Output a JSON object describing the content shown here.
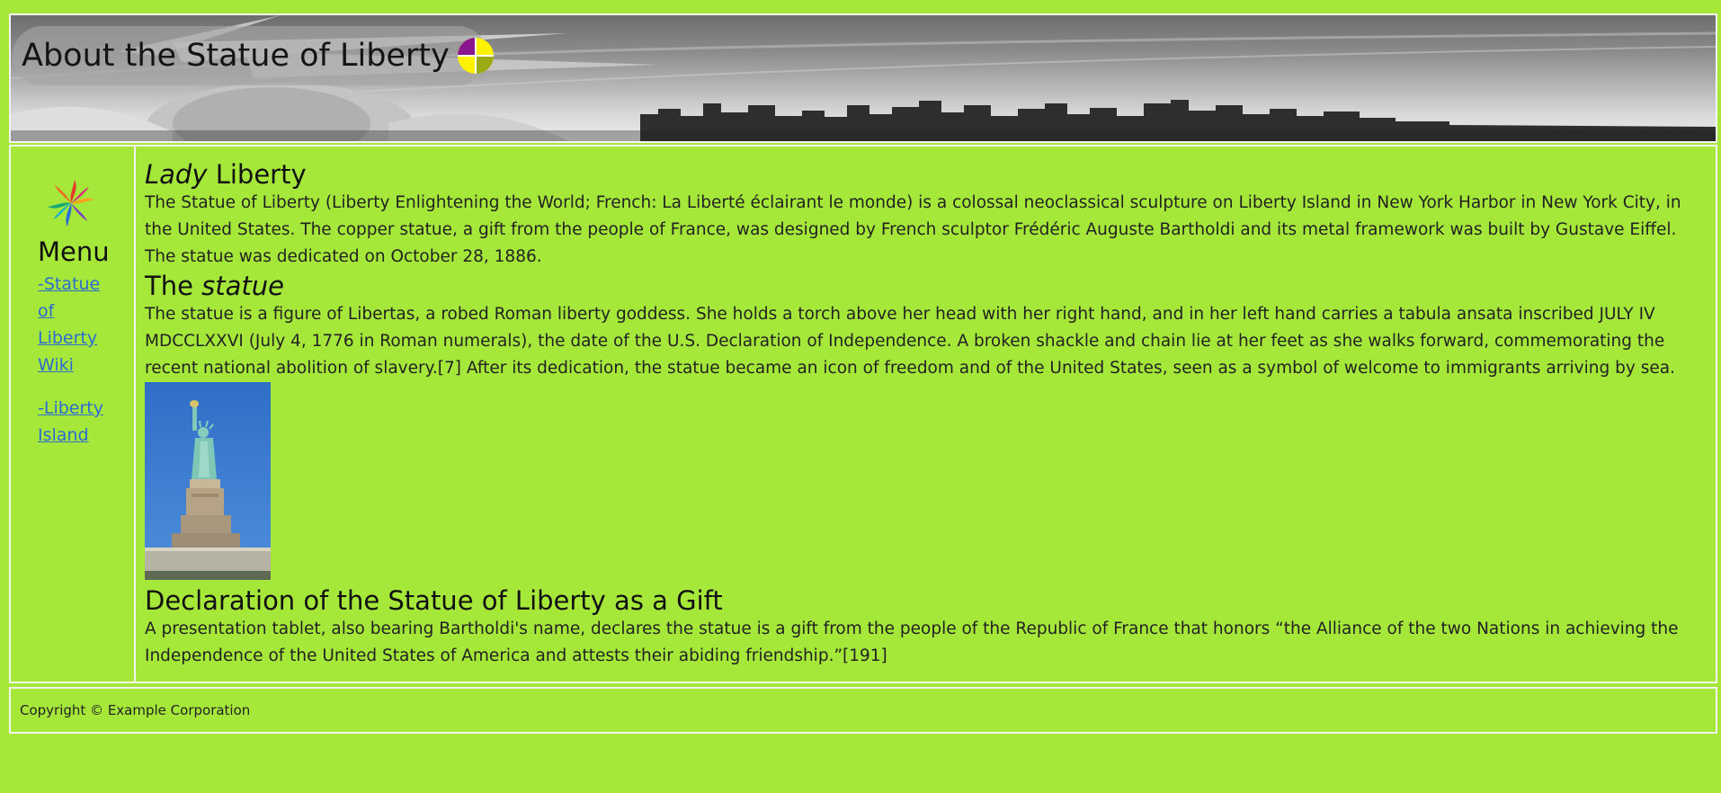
{
  "header": {
    "title": "About the Statue of Liberty",
    "logo_colors": [
      "#8a168f",
      "#fff200",
      "#9aaa10",
      "#fff200"
    ]
  },
  "sidebar": {
    "menu_title": "Menu",
    "links": [
      {
        "label": "-Statue of Liberty Wiki"
      },
      {
        "label": "-Liberty Island"
      }
    ]
  },
  "main": {
    "section1": {
      "heading_italic": "Lady",
      "heading_rest": " Liberty",
      "text": "The Statue of Liberty (Liberty Enlightening the World; French: La Liberté éclairant le monde) is a colossal neoclassical sculpture on Liberty Island in New York Harbor in New York City, in the United States. The copper statue, a gift from the people of France, was designed by French sculptor Frédéric Auguste Bartholdi and its metal framework was built by Gustave Eiffel. The statue was dedicated on October 28, 1886."
    },
    "section2": {
      "heading_plain": "The ",
      "heading_italic": "statue",
      "text": "The statue is a figure of Libertas, a robed Roman liberty goddess. She holds a torch above her head with her right hand, and in her left hand carries a tabula ansata inscribed JULY IV MDCCLXXVI (July 4, 1776 in Roman numerals), the date of the U.S. Declaration of Independence. A broken shackle and chain lie at her feet as she walks forward, commemorating the recent national abolition of slavery.[7] After its dedication, the statue became an icon of freedom and of the United States, seen as a symbol of welcome to immigrants arriving by sea."
    },
    "section3": {
      "heading": "Declaration of the Statue of Liberty as a Gift",
      "text": "A presentation tablet, also bearing Bartholdi's name, declares the statue is a gift from the people of the Republic of France that honors “the Alliance of the two Nations in achieving the Independence of the United States of America and attests their abiding friendship.”[191]"
    }
  },
  "footer": {
    "copyright": "Copyright © Example Corporation"
  },
  "colors": {
    "page_background": "#a6e83a",
    "link": "#2c6bd1",
    "border": "#f2f2f2"
  }
}
